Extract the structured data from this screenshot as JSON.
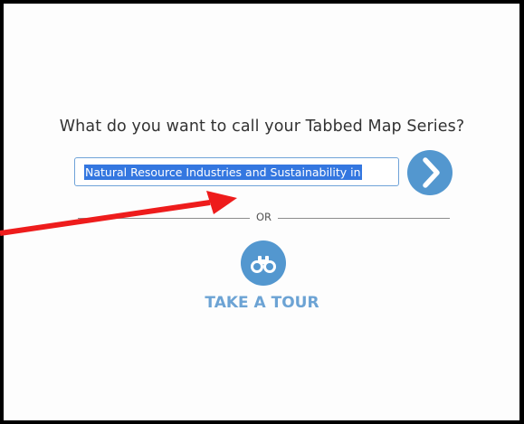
{
  "dialog": {
    "title": "What do you want to call your Tabbed Map Series?",
    "name_input": {
      "value": "Natural Resource Industries and Sustainability in",
      "selected": true
    },
    "next_button": {
      "icon": "chevron-right-icon"
    },
    "divider_label": "OR",
    "tour": {
      "icon": "binoculars-icon",
      "label": "TAKE A TOUR"
    }
  },
  "colors": {
    "accent": "#5397cf",
    "tour_text": "#6ca3d4",
    "selection": "#3477e0",
    "annotation_arrow": "#ee1c1c",
    "frame_border": "#000000"
  }
}
